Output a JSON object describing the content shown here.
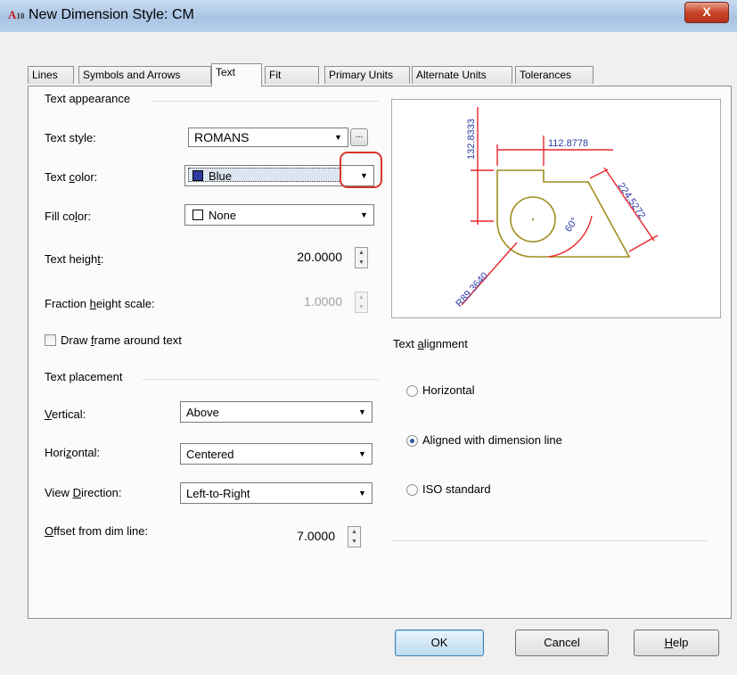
{
  "window": {
    "app_icon_label": "A",
    "app_icon_suffix": "10",
    "title": "New Dimension Style: CM",
    "close_glyph": "X"
  },
  "tabs": [
    {
      "label": "Lines",
      "active": false
    },
    {
      "label": "Symbols and Arrows",
      "active": false
    },
    {
      "label": "Text",
      "active": true
    },
    {
      "label": "Fit",
      "active": false
    },
    {
      "label": "Primary Units",
      "active": false
    },
    {
      "label": "Alternate Units",
      "active": false
    },
    {
      "label": "Tolerances",
      "active": false
    }
  ],
  "text_appearance": {
    "group_label": "Text appearance",
    "text_style": {
      "label": "Text style:",
      "value": "ROMANS",
      "browse": "..."
    },
    "text_color": {
      "label": "Text color:",
      "value": "Blue",
      "swatch": "#2d3a9e"
    },
    "fill_color": {
      "label": "Fill color:",
      "value": "None",
      "swatch": "#ffffff"
    },
    "text_height": {
      "label": "Text height:",
      "value": "20.0000"
    },
    "fraction_height_scale": {
      "label": "Fraction height scale:",
      "value": "1.0000",
      "enabled": false
    },
    "draw_frame": {
      "label": "Draw frame around text",
      "checked": false
    }
  },
  "text_placement": {
    "group_label": "Text placement",
    "vertical": {
      "label": "Vertical:",
      "value": "Above"
    },
    "horizontal": {
      "label": "Horizontal:",
      "value": "Centered"
    },
    "view_direction": {
      "label": "View Direction:",
      "value": "Left-to-Right"
    },
    "offset": {
      "label": "Offset from dim line:",
      "value": "7.0000"
    }
  },
  "preview": {
    "dim_vertical": "132.8333",
    "dim_horizontal": "112.8778",
    "dim_aligned": "224.5272",
    "dim_angle": "60°",
    "dim_radius": "R89.3640",
    "colors": {
      "dimension": "#e8262c",
      "text": "#2a3aa8",
      "object": "#a08c1e"
    }
  },
  "text_alignment": {
    "group_label": "Text alignment",
    "options": [
      {
        "label": "Horizontal",
        "selected": false
      },
      {
        "label": "Aligned with dimension line",
        "selected": true
      },
      {
        "label": "ISO standard",
        "selected": false
      }
    ]
  },
  "buttons": {
    "ok": "OK",
    "cancel": "Cancel",
    "help": "Help"
  },
  "icons": {
    "dropdown_arrow": "▼",
    "spin_up": "▲",
    "spin_down": "▼"
  }
}
